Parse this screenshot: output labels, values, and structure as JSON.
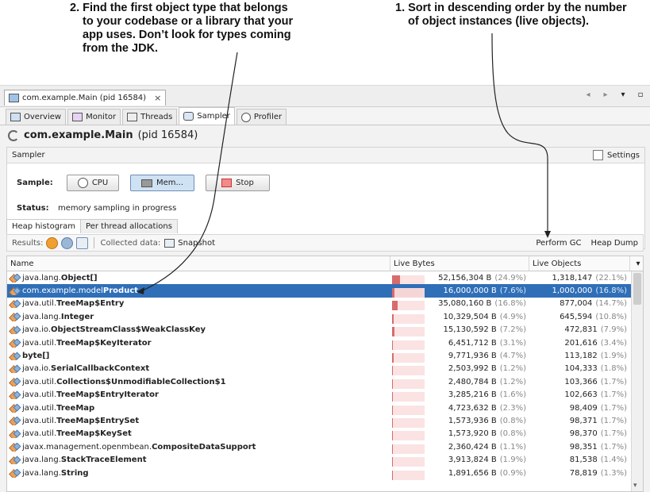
{
  "annotations": {
    "step2": [
      "2. Find the first object type that belongs",
      "to your codebase or a library that your",
      "app uses. Don’t look for types coming",
      "from the JDK."
    ],
    "step1": [
      "1. Sort in descending order by the number",
      "of object instances (live objects)."
    ]
  },
  "window": {
    "doc_tab": "com.example.Main (pid 16584)",
    "doc_tab_close": "×",
    "controls": [
      "◂",
      "▸",
      "▾",
      "▫"
    ]
  },
  "app_tabs": [
    {
      "label": "Overview",
      "icon": "overview-icon"
    },
    {
      "label": "Monitor",
      "icon": "monitor-icon"
    },
    {
      "label": "Threads",
      "icon": "threads-icon"
    },
    {
      "label": "Sampler",
      "icon": "sampler-icon",
      "active": true
    },
    {
      "label": "Profiler",
      "icon": "profiler-icon"
    }
  ],
  "title": {
    "app": "com.example.Main",
    "pid": "(pid 16584)"
  },
  "sampler_panel": {
    "header": "Sampler",
    "settings_label": "Settings",
    "sample_label": "Sample:",
    "cpu_button": "CPU",
    "mem_button": "Mem...",
    "stop_button": "Stop",
    "status_label": "Status:",
    "status_value": "memory sampling in progress"
  },
  "sub_tabs": [
    "Heap histogram",
    "Per thread allocations"
  ],
  "results_bar": {
    "results_label": "Results:",
    "collected_label": "Collected data:",
    "snapshot_label": "Snapshot",
    "perform_gc": "Perform GC",
    "heap_dump": "Heap Dump"
  },
  "table": {
    "columns": [
      "Name",
      "Live Bytes",
      "Live Objects"
    ],
    "sort_indicator": "▾",
    "rows": [
      {
        "pkg": "java.lang.",
        "cls": "Object[]",
        "bytes": "52,156,304 B",
        "bytes_pct": "(24.9%)",
        "bar": 0.249,
        "objs": "1,318,147",
        "objs_pct": "(22.1%)"
      },
      {
        "pkg": "com.example.model",
        "cls": "Product",
        "bytes": "16,000,000 B",
        "bytes_pct": "(7.6%)",
        "bar": 0.076,
        "objs": "1,000,000",
        "objs_pct": "(16.8%)",
        "selected": true
      },
      {
        "pkg": "java.util.",
        "cls": "TreeMap$Entry",
        "bytes": "35,080,160 B",
        "bytes_pct": "(16.8%)",
        "bar": 0.168,
        "objs": "877,004",
        "objs_pct": "(14.7%)"
      },
      {
        "pkg": "java.lang.",
        "cls": "Integer",
        "bytes": "10,329,504 B",
        "bytes_pct": "(4.9%)",
        "bar": 0.049,
        "objs": "645,594",
        "objs_pct": "(10.8%)"
      },
      {
        "pkg": "java.io.",
        "cls": "ObjectStreamClass$WeakClassKey",
        "bytes": "15,130,592 B",
        "bytes_pct": "(7.2%)",
        "bar": 0.072,
        "objs": "472,831",
        "objs_pct": "(7.9%)"
      },
      {
        "pkg": "java.util.",
        "cls": "TreeMap$KeyIterator",
        "bytes": "6,451,712 B",
        "bytes_pct": "(3.1%)",
        "bar": 0.031,
        "objs": "201,616",
        "objs_pct": "(3.4%)"
      },
      {
        "pkg": "",
        "cls": "byte[]",
        "bytes": "9,771,936 B",
        "bytes_pct": "(4.7%)",
        "bar": 0.047,
        "objs": "113,182",
        "objs_pct": "(1.9%)"
      },
      {
        "pkg": "java.io.",
        "cls": "SerialCallbackContext",
        "bytes": "2,503,992 B",
        "bytes_pct": "(1.2%)",
        "bar": 0.012,
        "objs": "104,333",
        "objs_pct": "(1.8%)"
      },
      {
        "pkg": "java.util.",
        "cls": "Collections$UnmodifiableCollection$1",
        "bytes": "2,480,784 B",
        "bytes_pct": "(1.2%)",
        "bar": 0.012,
        "objs": "103,366",
        "objs_pct": "(1.7%)"
      },
      {
        "pkg": "java.util.",
        "cls": "TreeMap$EntryIterator",
        "bytes": "3,285,216 B",
        "bytes_pct": "(1.6%)",
        "bar": 0.016,
        "objs": "102,663",
        "objs_pct": "(1.7%)"
      },
      {
        "pkg": "java.util.",
        "cls": "TreeMap",
        "bytes": "4,723,632 B",
        "bytes_pct": "(2.3%)",
        "bar": 0.023,
        "objs": "98,409",
        "objs_pct": "(1.7%)"
      },
      {
        "pkg": "java.util.",
        "cls": "TreeMap$EntrySet",
        "bytes": "1,573,936 B",
        "bytes_pct": "(0.8%)",
        "bar": 0.008,
        "objs": "98,371",
        "objs_pct": "(1.7%)"
      },
      {
        "pkg": "java.util.",
        "cls": "TreeMap$KeySet",
        "bytes": "1,573,920 B",
        "bytes_pct": "(0.8%)",
        "bar": 0.008,
        "objs": "98,370",
        "objs_pct": "(1.7%)"
      },
      {
        "pkg": "javax.management.openmbean.",
        "cls": "CompositeDataSupport",
        "bytes": "2,360,424 B",
        "bytes_pct": "(1.1%)",
        "bar": 0.011,
        "objs": "98,351",
        "objs_pct": "(1.7%)"
      },
      {
        "pkg": "java.lang.",
        "cls": "StackTraceElement",
        "bytes": "3,913,824 B",
        "bytes_pct": "(1.9%)",
        "bar": 0.019,
        "objs": "81,538",
        "objs_pct": "(1.4%)"
      },
      {
        "pkg": "java.lang.",
        "cls": "String",
        "bytes": "1,891,656 B",
        "bytes_pct": "(0.9%)",
        "bar": 0.009,
        "objs": "78,819",
        "objs_pct": "(1.3%)"
      }
    ]
  },
  "colors": {
    "selection": "#2f6fb8",
    "bar": "#d86b6b",
    "bar_bg": "#fbe3e3"
  }
}
